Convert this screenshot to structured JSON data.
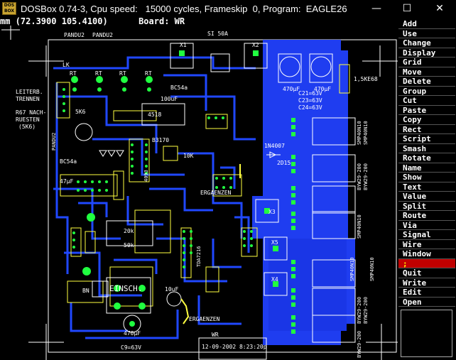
{
  "window": {
    "title": "DOSBox 0.74-3, Cpu speed:   15000 cycles, Frameskip  0, Program:  EAGLE26",
    "icon_text": "DOS BOX"
  },
  "status": {
    "coords": "mm (72.3900 105.4100)",
    "board_label": "Board: WR"
  },
  "menu": {
    "items": [
      "Add",
      "Use",
      "Change",
      "Display",
      "Grid",
      "Move",
      "Delete",
      "Group",
      "Cut",
      "Paste",
      "Copy",
      "Rect",
      "Script",
      "Smash",
      "Rotate",
      "Name",
      "Show",
      "Text",
      "Value",
      "Split",
      "Route",
      "Via",
      "Signal",
      "Wire",
      "Window",
      ";",
      "Quit",
      "Write",
      "Edit",
      "Open"
    ],
    "selected_index": 25
  },
  "board": {
    "labels": {
      "pandu2a": "PANDU2",
      "pandu2b": "PANDU2",
      "x1": "X1",
      "si50a": "SI 50A",
      "x2": "X2",
      "rt1": "RT",
      "rt2": "RT",
      "rt3": "RT",
      "rt4": "RT",
      "lk": "LK",
      "leiterb1": "LEITERB.",
      "leiterb2": "TRENNEN",
      "r67a": "R67 NACH-",
      "r67b": "RUESTEN",
      "r67c": "(5K6)",
      "bc54a": "BC54a",
      "c100": "100uF",
      "ic4518": "4518",
      "cap470a": "470µF",
      "cap470b": "470µF",
      "d15ke": "1,5KE68",
      "c21": "C21=63V",
      "c23": "C23=63V",
      "c24": "C24=63V",
      "pandu2v": "PANDU2",
      "bc54b": "BC54a",
      "b3170": "B3170",
      "r5k6": "5K6",
      "r10k": "10K",
      "d1n4007": "1N4007",
      "d2d15": "2D15",
      "ic4093": "4093",
      "c47": "47µF",
      "erg1": "ERGAENZEN",
      "x3": "X3",
      "x5": "X5",
      "x4": "X4",
      "r20k": "20k",
      "r50k": "50k",
      "tda": "TDA7216",
      "bn": "BN",
      "einsch": "EINSCH.",
      "c10": "10uF",
      "erg2": "ERGAENZEN",
      "c470c": "470µF",
      "c9": "C9=63V",
      "wr": "WR",
      "date": "12-09-2002  8:23:20p",
      "smp1": "SMP40N10",
      "smp2": "SMP40N10",
      "byw1": "BYW29-200",
      "byw2": "BYW29-200",
      "smp3": "SMP40N10",
      "smp4": "SMP40N10",
      "byw3": "BYW29-200",
      "byw4": "BYW29-200",
      "smp5": "SMP40N10",
      "byw5": "BYW29-200"
    }
  }
}
